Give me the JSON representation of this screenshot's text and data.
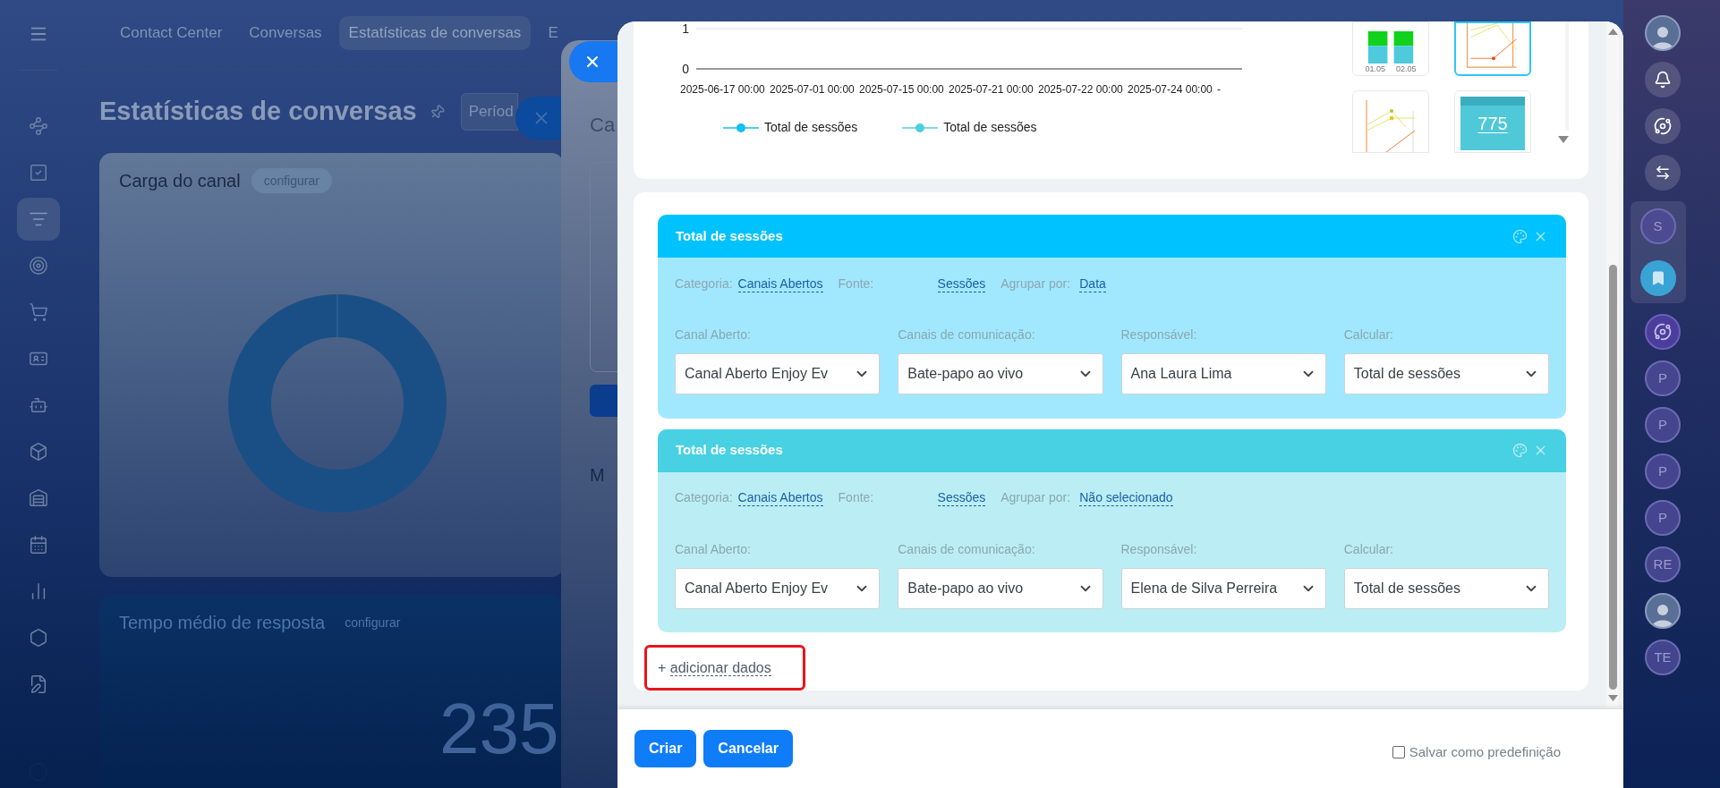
{
  "left_sidebar": {
    "items": [
      {
        "kind": "connections",
        "selected": false
      },
      {
        "kind": "tasks",
        "selected": false
      },
      {
        "kind": "funnel",
        "selected": true
      },
      {
        "kind": "target",
        "selected": false
      },
      {
        "kind": "cart",
        "selected": false
      },
      {
        "kind": "contact-card",
        "selected": false
      },
      {
        "kind": "robot",
        "selected": false
      },
      {
        "kind": "box",
        "selected": false
      },
      {
        "kind": "warehouse",
        "selected": false
      },
      {
        "kind": "calendar",
        "selected": false
      },
      {
        "kind": "bar-chart",
        "selected": false
      },
      {
        "kind": "hexagon",
        "selected": false
      },
      {
        "kind": "document",
        "selected": false
      }
    ]
  },
  "top_nav": {
    "items": [
      {
        "label": "Contact Center",
        "selected": false
      },
      {
        "label": "Conversas",
        "selected": false
      },
      {
        "label": "Estatísticas de conversas",
        "selected": true
      },
      {
        "label": "E",
        "selected": false
      }
    ]
  },
  "page": {
    "title": "Estatísticas de conversas",
    "period_button": "Períod"
  },
  "widgets": [
    {
      "kind": "donut",
      "title": "Carga do canal",
      "action": "configurar"
    },
    {
      "kind": "number",
      "title": "Tempo médio de resposta",
      "action": "configurar",
      "value": "235"
    }
  ],
  "back_panel": {
    "heading": "Ca",
    "label": "M"
  },
  "chart_panel": {
    "chart": {
      "y_labels": [
        "1",
        "0"
      ],
      "x_labels": [
        "2025-06-17 00:00",
        "2025-07-01 00:00",
        "2025-07-15 00:00",
        "2025-07-21 00:00",
        "2025-07-22 00:00",
        "2025-07-24 00:00",
        "-"
      ],
      "legend": [
        {
          "label": "Total de sessões",
          "color": "#10bff4"
        },
        {
          "label": "Total de sessões",
          "color": "#4ccfdd"
        }
      ]
    },
    "chart_types": [
      {
        "kind": "bar",
        "selected": false,
        "labels": [
          "01.05",
          "02.05"
        ]
      },
      {
        "kind": "line",
        "selected": true
      },
      {
        "kind": "multi-line",
        "selected": false
      },
      {
        "kind": "number",
        "selected": false,
        "value": "775"
      }
    ]
  },
  "datasets": [
    {
      "title": "Total de sessões",
      "color": "#00c2ff",
      "filters": [
        {
          "label": "Categoria:",
          "value": "Canais Abertos"
        },
        {
          "label": "Fonte:",
          "value": "Sessões"
        },
        {
          "label": "Agrupar por:",
          "value": "Data"
        }
      ],
      "selects": [
        {
          "label": "Canal Aberto:",
          "value": "Canal Aberto Enjoy Ev"
        },
        {
          "label": "Canais de comunicação:",
          "value": "Bate-papo ao vivo"
        },
        {
          "label": "Responsável:",
          "value": "Ana Laura Lima"
        },
        {
          "label": "Calcular:",
          "value": "Total de sessões"
        }
      ]
    },
    {
      "title": "Total de sessões",
      "color": "#47d1e2",
      "filters": [
        {
          "label": "Categoria:",
          "value": "Canais Abertos"
        },
        {
          "label": "Fonte:",
          "value": "Sessões"
        },
        {
          "label": "Agrupar por:",
          "value": "Não selecionado"
        }
      ],
      "selects": [
        {
          "label": "Canal Aberto:",
          "value": "Canal Aberto Enjoy Ev"
        },
        {
          "label": "Canais de comunicação:",
          "value": "Bate-papo ao vivo"
        },
        {
          "label": "Responsável:",
          "value": "Elena de Silva Perreira"
        },
        {
          "label": "Calcular:",
          "value": "Total de sessões"
        }
      ]
    }
  ],
  "add_data": {
    "icon": "+",
    "label": "adicionar dados"
  },
  "footer": {
    "buttons": [
      "Criar",
      "Cancelar"
    ],
    "preset": {
      "label": "Salvar como predefinição",
      "checked": false
    }
  },
  "right_bar": {
    "items": [
      {
        "kind": "avatar"
      },
      {
        "kind": "bell"
      },
      {
        "kind": "orbit"
      },
      {
        "kind": "chat-arrows"
      },
      {
        "kind": "letter",
        "label": "S",
        "grouped": true
      },
      {
        "kind": "bookmark",
        "grouped": true
      },
      {
        "kind": "orbit-round"
      },
      {
        "kind": "letter",
        "label": "P"
      },
      {
        "kind": "letter",
        "label": "P"
      },
      {
        "kind": "letter",
        "label": "P"
      },
      {
        "kind": "letter",
        "label": "P"
      },
      {
        "kind": "letter",
        "label": "RE"
      },
      {
        "kind": "avatar"
      },
      {
        "kind": "letter",
        "label": "TE"
      }
    ]
  }
}
